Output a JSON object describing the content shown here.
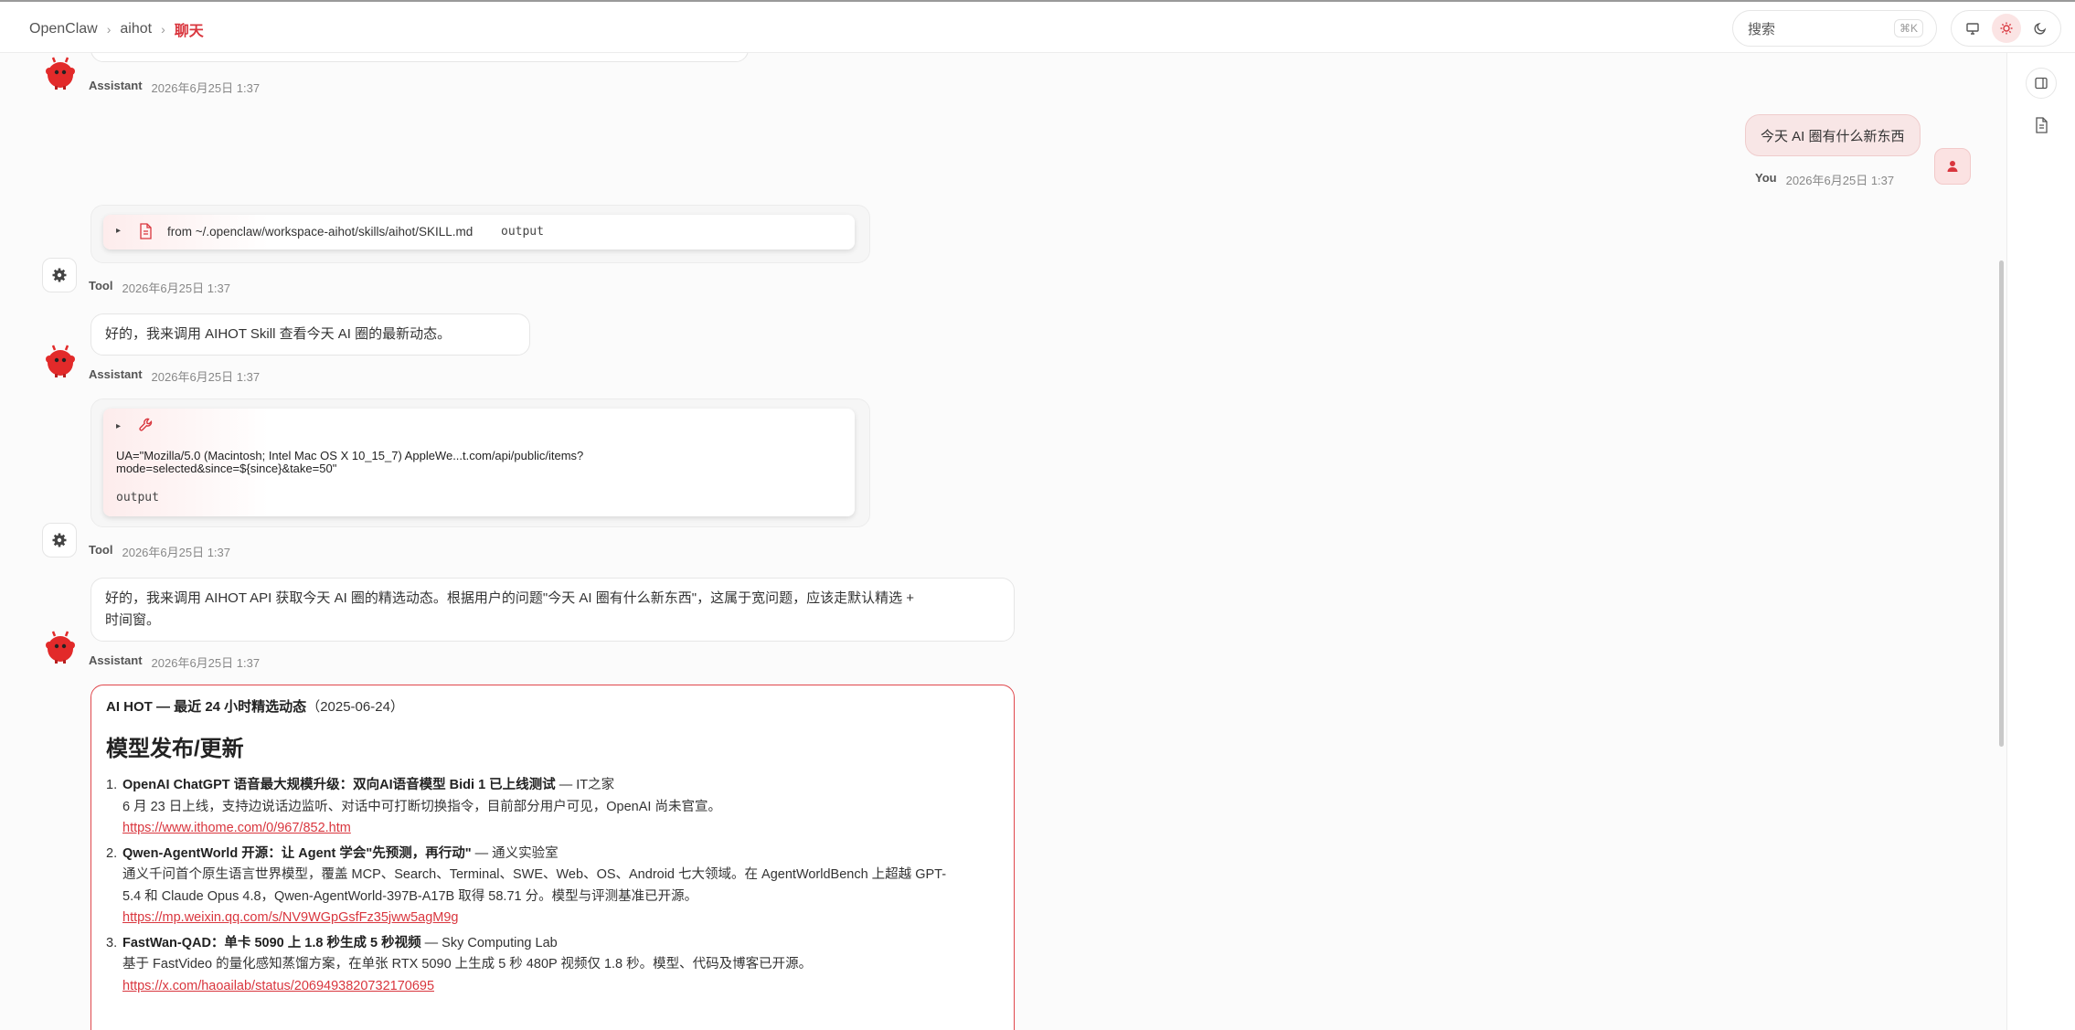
{
  "breadcrumb": {
    "root": "OpenClaw",
    "workspace": "aihot",
    "current": "聊天"
  },
  "search": {
    "placeholder": "搜索",
    "shortcut": "⌘K"
  },
  "theme": {
    "options": [
      "monitor-icon",
      "sun-icon",
      "moon-icon"
    ],
    "active": "sun-icon"
  },
  "colors": {
    "accent": "#d9363e",
    "user_bubble": "#f8e6e6"
  },
  "messages": {
    "m0": {
      "role": "Assistant",
      "time": "2026年6月25日 1:37"
    },
    "m1": {
      "role": "You",
      "text": "今天 AI 圈有什么新东西",
      "time": "2026年6月25日 1:37"
    },
    "m2": {
      "role": "Tool",
      "time": "2026年6月25日 1:37",
      "source": "from ~/.openclaw/workspace-aihot/skills/aihot/SKILL.md",
      "output": "output"
    },
    "m3": {
      "role": "Assistant",
      "text": "好的，我来调用 AIHOT Skill 查看今天 AI 圈的最新动态。",
      "time": "2026年6月25日 1:37"
    },
    "m4": {
      "role": "Tool",
      "time": "2026年6月25日 1:37",
      "command_line1": "UA=\"Mozilla/5.0 (Macintosh; Intel Mac OS X 10_15_7) AppleWe...t.com/api/public/items?",
      "command_line2": "mode=selected&since=${since}&take=50\"",
      "output": "output"
    },
    "m5": {
      "role": "Assistant",
      "text_line1": "好的，我来调用 AIHOT API 获取今天 AI 圈的精选动态。根据用户的问题\"今天 AI 圈有什么新东西\"，这属于宽问题，应该走默认精选 +",
      "text_line2": "时间窗。",
      "time": "2026年6月25日 1:37"
    }
  },
  "ai_hot": {
    "title_bold": "AI HOT — 最近 24 小时精选动态",
    "title_date": "（2025-06-24）",
    "section": "模型发布/更新",
    "items": [
      {
        "num": "1.",
        "headline": "OpenAI ChatGPT 语音最大规模升级：双向AI语音模型 Bidi 1 已上线测试",
        "source": " — IT之家",
        "desc": "6 月 23 日上线，支持边说话边监听、对话中可打断切换指令，目前部分用户可见，OpenAI 尚未官宣。",
        "link": "https://www.ithome.com/0/967/852.htm"
      },
      {
        "num": "2.",
        "headline": "Qwen-AgentWorld 开源：让 Agent 学会\"先预测，再行动\"",
        "source": " — 通义实验室",
        "desc": "通义千问首个原生语言世界模型，覆盖 MCP、Search、Terminal、SWE、Web、OS、Android 七大领域。在 AgentWorldBench 上超越 GPT-5.4 和 Claude Opus 4.8，Qwen-AgentWorld-397B-A17B 取得 58.71 分。模型与评测基准已开源。",
        "link": "https://mp.weixin.qq.com/s/NV9WGpGsfFz35jww5agM9g"
      },
      {
        "num": "3.",
        "headline": "FastWan-QAD：单卡 5090 上 1.8 秒生成 5 秒视频",
        "source": " — Sky Computing Lab",
        "desc": "基于 FastVideo 的量化感知蒸馏方案，在单张 RTX 5090 上生成 5 秒 480P 视频仅 1.8 秒。模型、代码及博客已开源。",
        "link": "https://x.com/haoailab/status/2069493820732170695"
      }
    ]
  }
}
